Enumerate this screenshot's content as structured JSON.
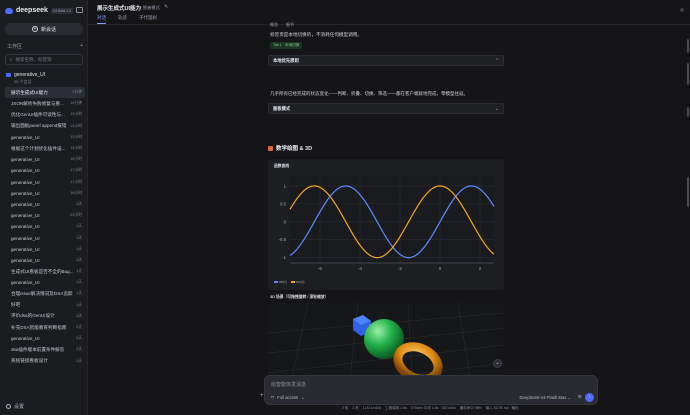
{
  "sidebar": {
    "logo": "deepseek",
    "version": "V4 Beta 1.0",
    "new_chat": "新会话",
    "workspace_label": "工作区",
    "search_placeholder": "搜索名称、标签等",
    "project": {
      "name": "generative_UI",
      "count": "35 个会话"
    },
    "chats": [
      {
        "title": "展示生成式UI能力",
        "time": "2分钟",
        "active": true
      },
      {
        "title": "JSON解析失败修复与重...",
        "time": "12分钟"
      },
      {
        "title": "优化GenUI插件可读性与...",
        "time": "13小时"
      },
      {
        "title": "输出面板panel append报错",
        "time": "13小时"
      },
      {
        "title": "generative_UI",
        "time": "13小时"
      },
      {
        "title": "根据这个计划优化插件设...",
        "time": "13小时"
      },
      {
        "title": "generative_UI",
        "time": "15小时"
      },
      {
        "title": "generative_UI",
        "time": "17小时"
      },
      {
        "title": "generative_UI",
        "time": "17小时"
      },
      {
        "title": "generative_UI",
        "time": "18小时"
      },
      {
        "title": "generative_UI",
        "time": "1天"
      },
      {
        "title": "generative_UI",
        "time": "23小时"
      },
      {
        "title": "generative_UI",
        "time": "1天"
      },
      {
        "title": "generative_UI",
        "time": "1天"
      },
      {
        "title": "generative_UI",
        "time": "1天"
      },
      {
        "title": "generative_UI",
        "time": "1天"
      },
      {
        "title": "生成式UI看板是否不全的Bug...",
        "time": "1天"
      },
      {
        "title": "generative_UI",
        "time": "1天"
      },
      {
        "title": "合理issue解决情况及DSA追踪",
        "time": "1天"
      },
      {
        "title": "好吧",
        "time": "1天"
      },
      {
        "title": "评价dsa的GenUI设计",
        "time": "1天"
      },
      {
        "title": "补充DSA智能教育判断指南",
        "time": "2天"
      },
      {
        "title": "generative_UI",
        "time": "2天"
      },
      {
        "title": "dsa插件版本前置条件解答",
        "time": "2天"
      },
      {
        "title": "系统链接看板设计",
        "time": "2天"
      }
    ],
    "settings": "设置"
  },
  "header": {
    "title": "展示生成式UI能力",
    "mode": "智者模式",
    "tabs": [
      "对话",
      "轨迹",
      "子代理树"
    ]
  },
  "content": {
    "mini_tabs": [
      "概览",
      "细节"
    ],
    "hint": "标签页是本地切换的，不消耗任何模型调用。",
    "badge": "Tab 1 · 本地切换",
    "acc1": "本地优先原则",
    "acc1_body": "几乎所有已经完成的状态变化——判断、折叠、切换、筛选——都在客户端就地完成，零模型往返。",
    "acc2": "面板模式",
    "section": "数学绘图 & 3D",
    "d3_title": "3D 场景（可拖拽旋转 / 滚轮缩放）"
  },
  "chart_data": {
    "type": "line",
    "title": "函数曲线",
    "xlabel": "",
    "ylabel": "",
    "xlim": [
      -7.5,
      2.7
    ],
    "ylim": [
      -1.15,
      1.25
    ],
    "x_ticks": [
      -6,
      -4,
      -2,
      0,
      2
    ],
    "y_ticks": [
      1,
      0.5,
      0,
      -0.5,
      -1
    ],
    "y_tick_labels": [
      "1",
      "0.5",
      "0",
      "-0.5",
      "-1"
    ],
    "grid": true,
    "legend": "bottom-left",
    "series": [
      {
        "name": "sin(x)",
        "function": "sin",
        "color": "#5b8cff"
      },
      {
        "name": "cos(x)",
        "function": "cos",
        "color": "#f5a623"
      }
    ]
  },
  "composer": {
    "placeholder": "给智能体发消息",
    "access": "Full access",
    "model": "DeepSeek-V4-Flash Max",
    "status": [
      "2 轮",
      "2 秒",
      "LLM 1m10s",
      "工具调用 1.6s",
      "0 Token 平均 1.6s · 150 tok/s",
      "缓存命中 98%",
      "输入 82.0K tok · 输出"
    ]
  },
  "colors": {
    "accent": "#4d6bfe",
    "sin": "#5b8cff",
    "cos": "#f5a623"
  }
}
